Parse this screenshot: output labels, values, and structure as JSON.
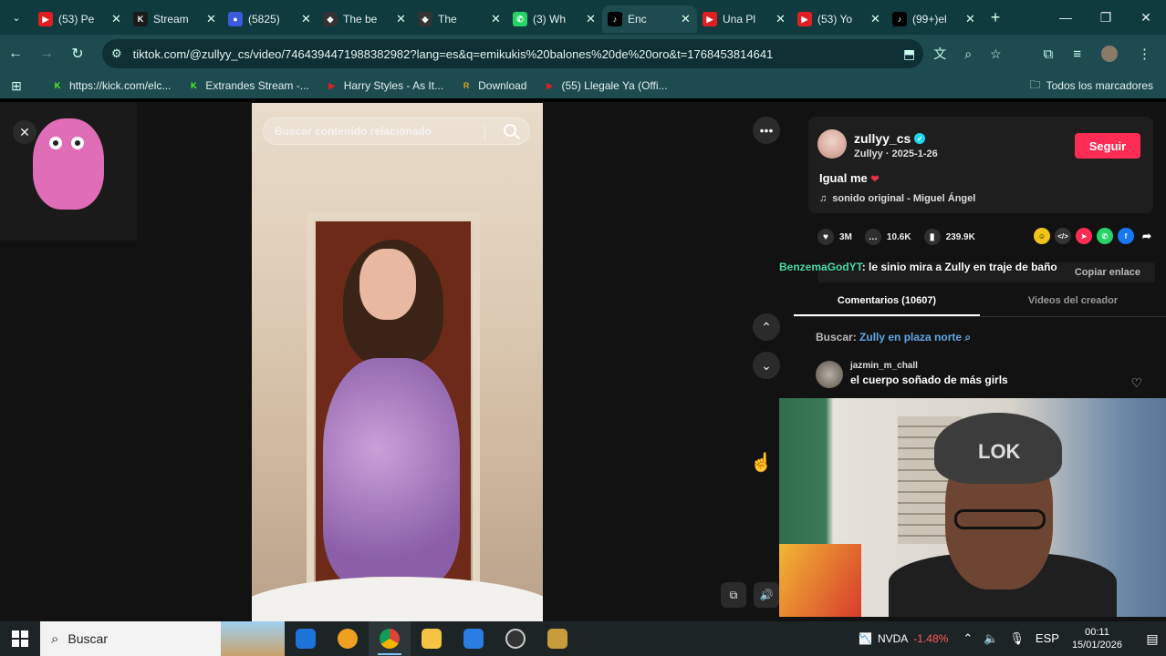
{
  "browser": {
    "tabs": [
      {
        "title": "(53) Pe",
        "fav_color": "#e02020",
        "fav_glyph": "▶",
        "active": false
      },
      {
        "title": "Stream",
        "fav_color": "#1a1a1a",
        "fav_glyph": "K",
        "active": false
      },
      {
        "title": "(5825)",
        "fav_color": "#3c5bdc",
        "fav_glyph": "●",
        "active": false
      },
      {
        "title": "The be",
        "fav_color": "#333",
        "fav_glyph": "◆",
        "active": false
      },
      {
        "title": "The",
        "fav_color": "#333",
        "fav_glyph": "◆",
        "active": false
      },
      {
        "title": "(3) Wh",
        "fav_color": "#25d366",
        "fav_glyph": "✆",
        "active": false
      },
      {
        "title": "Enc",
        "fav_color": "#000",
        "fav_glyph": "♪",
        "active": true
      },
      {
        "title": "Una Pl",
        "fav_color": "#e02020",
        "fav_glyph": "▶",
        "active": false
      },
      {
        "title": "(53) Yo",
        "fav_color": "#e02020",
        "fav_glyph": "▶",
        "active": false
      },
      {
        "title": "(99+)el",
        "fav_color": "#000",
        "fav_glyph": "♪",
        "active": false
      }
    ],
    "url": "tiktok.com/@zullyy_cs/video/7464394471988382982?lang=es&q=emikukis%20balones%20de%20oro&t=1768453814641",
    "bookmarks": [
      {
        "label": "https://kick.com/elc...",
        "color": "#53fc18",
        "glyph": "K"
      },
      {
        "label": "Extrandes Stream -...",
        "color": "#53fc18",
        "glyph": "K"
      },
      {
        "label": "Harry Styles - As It...",
        "color": "#e02020",
        "glyph": "▶"
      },
      {
        "label": "Download",
        "color": "#e0a020",
        "glyph": "R"
      },
      {
        "label": "(55) Llegale Ya (Offi...",
        "color": "#e02020",
        "glyph": "▶"
      }
    ],
    "all_bookmarks": "Todos los marcadores"
  },
  "video": {
    "search_placeholder": "Buscar contenido relacionado"
  },
  "post": {
    "username": "zullyy_cs",
    "subline": "Zullyy · 2025-1-26",
    "follow_label": "Seguir",
    "caption": "Igual me",
    "sound": "sonido original - Miguel Ángel",
    "likes": "3M",
    "comments": "10.6K",
    "saves": "239.9K",
    "copy_link": "Copiar enlace"
  },
  "chat_overlay": {
    "user": "BenzemaGodYT",
    "message": ": le sinio mira a Zully en traje de baño"
  },
  "tabs2": {
    "comments": "Comentarios (10607)",
    "creator": "Videos del creador"
  },
  "related": {
    "prefix": "Buscar:",
    "query": "Zully en plaza norte"
  },
  "comment": {
    "user": "jazmin_m_chall",
    "text": "el cuerpo soñado de más girls"
  },
  "taskbar": {
    "search": "Buscar",
    "ticker": "NVDA",
    "change": "-1.48%",
    "lang": "ESP",
    "time": "00:11",
    "date": "15/01/2026"
  }
}
